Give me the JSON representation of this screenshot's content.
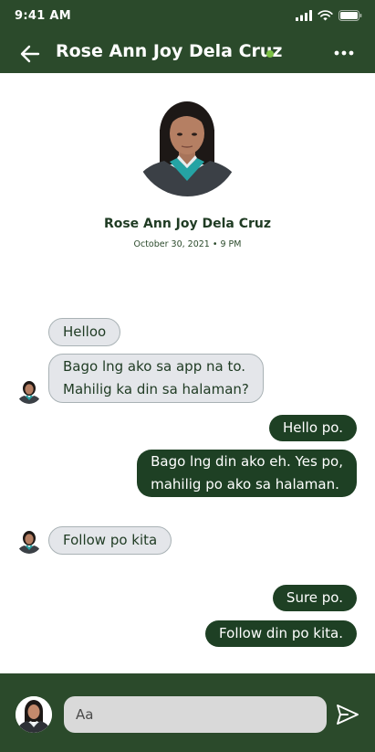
{
  "status_bar": {
    "time": "9:41 AM",
    "icons": [
      "signal-icon",
      "wifi-icon",
      "battery-icon"
    ]
  },
  "header": {
    "back_icon": "arrow-left-icon",
    "title": "Rose Ann Joy Dela Cruz",
    "online": true,
    "more_icon": "more-horizontal-icon"
  },
  "profile": {
    "name": "Rose Ann Joy Dela Cruz",
    "date": "October 30, 2021 • 9 PM"
  },
  "messages": [
    {
      "sender": "contact",
      "text": "Helloo",
      "show_avatar": false
    },
    {
      "sender": "contact",
      "lines": [
        "Bago lng ako sa app na to.",
        "Mahilig ka din sa halaman?"
      ],
      "show_avatar": true
    },
    {
      "sender": "me",
      "text": "Hello po."
    },
    {
      "sender": "me",
      "lines": [
        "Bago lng din ako eh. Yes po,",
        "mahilig po ako sa halaman."
      ]
    },
    {
      "sender": "contact",
      "text": "Follow po kita",
      "show_avatar": true
    },
    {
      "sender": "me",
      "text": "Sure po."
    },
    {
      "sender": "me",
      "text": "Follow din po kita."
    }
  ],
  "composer": {
    "placeholder": "Aa",
    "value": "",
    "send_icon": "send-icon"
  },
  "colors": {
    "header_bg": "#2b4a2b",
    "outgoing_bubble": "#1e4024",
    "incoming_bubble": "#e4e6ea",
    "online_dot": "#7bc043",
    "input_bg": "#d9d9d9"
  }
}
